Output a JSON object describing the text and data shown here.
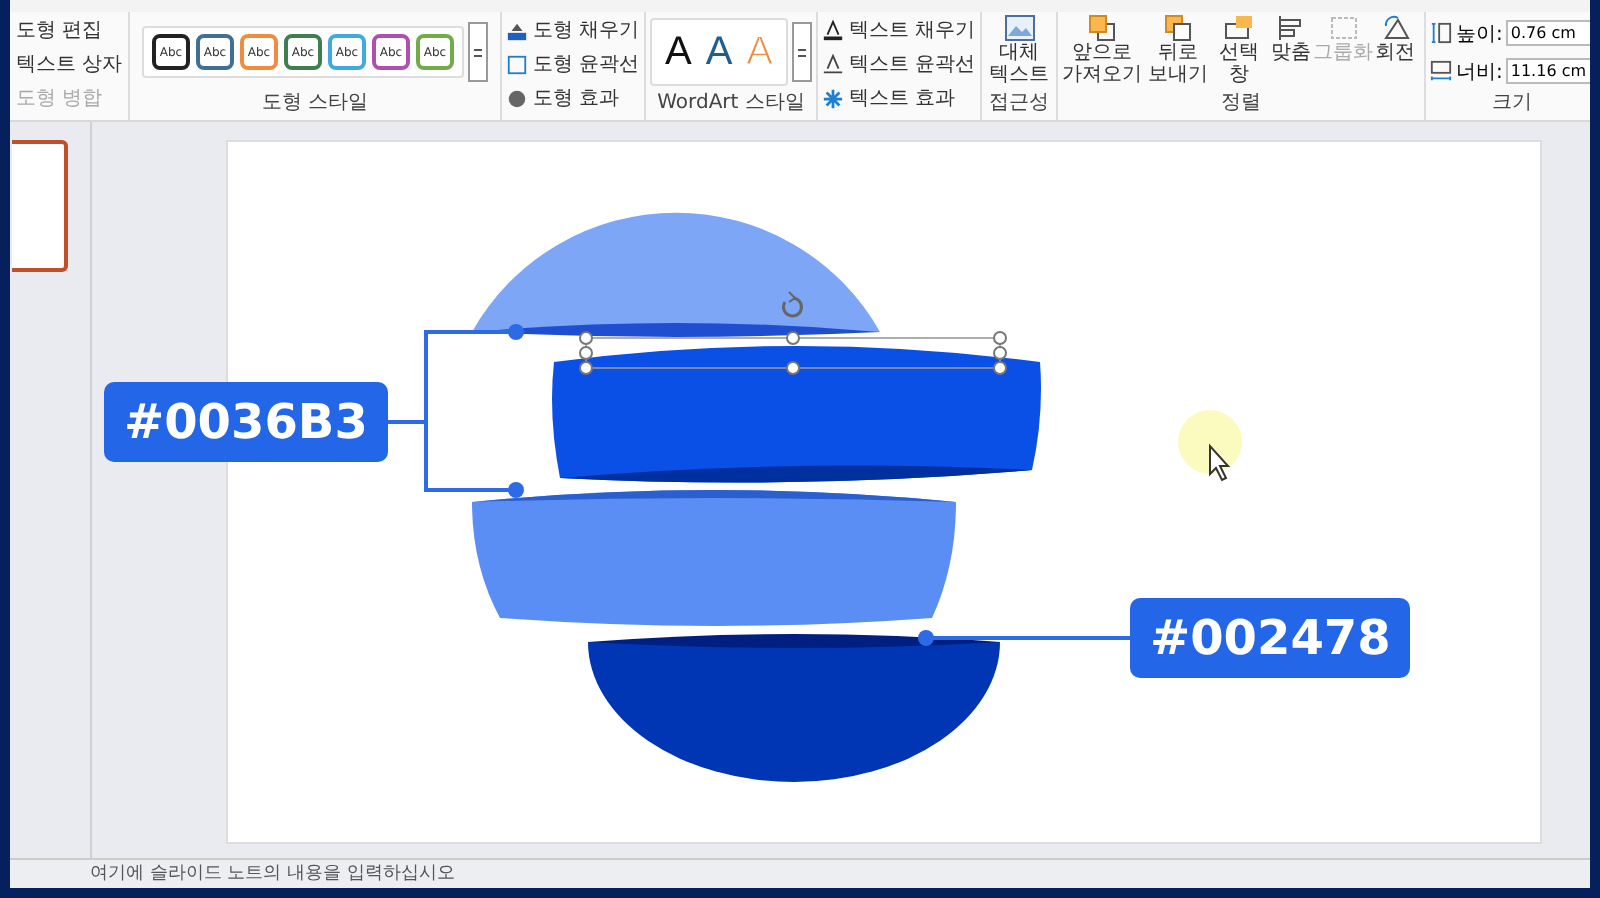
{
  "ribbon": {
    "edit_group": [
      {
        "label": "도형 편집",
        "disabled": false
      },
      {
        "label": "텍스트 상자",
        "disabled": false
      },
      {
        "label": "도형 병합",
        "disabled": true
      }
    ],
    "shape_styles": {
      "swatches": [
        {
          "label": "Abc",
          "color": "#222222"
        },
        {
          "label": "Abc",
          "color": "#3f6f95"
        },
        {
          "label": "Abc",
          "color": "#f08c40"
        },
        {
          "label": "Abc",
          "color": "#3f7f4f"
        },
        {
          "label": "Abc",
          "color": "#3fa9e0"
        },
        {
          "label": "Abc",
          "color": "#b04fb0"
        },
        {
          "label": "Abc",
          "color": "#70ad47"
        }
      ],
      "title": "도형 스타일"
    },
    "shape_format": [
      {
        "label": "도형 채우기",
        "kind": "fill"
      },
      {
        "label": "도형 윤곽선",
        "kind": "outline"
      },
      {
        "label": "도형 효과",
        "kind": "effect"
      }
    ],
    "wordart": {
      "letters": [
        {
          "label": "A",
          "kind": "solid",
          "color": "#111111"
        },
        {
          "label": "A",
          "kind": "solid",
          "color": "#1f5f8f"
        },
        {
          "label": "A",
          "kind": "outline",
          "color": "#f08c40"
        }
      ],
      "title": "WordArt 스타일"
    },
    "text_format": [
      {
        "label": "텍스트 채우기",
        "kind": "fill"
      },
      {
        "label": "텍스트 윤곽선",
        "kind": "outline"
      },
      {
        "label": "텍스트 효과",
        "kind": "effect"
      }
    ],
    "accessibility": {
      "button": "대체 텍스트",
      "title": "접근성"
    },
    "arrange": {
      "buttons": [
        {
          "label": "앞으로 가져오기",
          "kind": "forward",
          "disabled": false
        },
        {
          "label": "뒤로 보내기",
          "kind": "backward",
          "disabled": false
        },
        {
          "label": "선택 창",
          "kind": "pane",
          "disabled": false
        },
        {
          "label": "맞춤",
          "kind": "align",
          "disabled": false
        },
        {
          "label": "그룹화",
          "kind": "group",
          "disabled": true
        },
        {
          "label": "회전",
          "kind": "rotate",
          "disabled": false
        }
      ],
      "title": "정렬"
    },
    "size": {
      "fields": [
        {
          "label": "높이:",
          "value": "0.76 cm",
          "kind": "height"
        },
        {
          "label": "너비:",
          "value": "11.16 cm",
          "kind": "width"
        }
      ],
      "title": "크기"
    }
  },
  "slide": {
    "slices": [
      {
        "color": "#7ea6f6",
        "selected": false
      },
      {
        "color": "#0a4fe6",
        "selected": true
      },
      {
        "color": "#5a8ef5",
        "selected": false
      },
      {
        "color": "#0036b3",
        "selected": false
      }
    ],
    "callouts": [
      {
        "label": "#0036B3",
        "kind": "bracket"
      },
      {
        "label": "#002478",
        "kind": "line"
      }
    ]
  },
  "notes": {
    "placeholder": "여기에 슬라이드 노트의 내용을 입력하십시오"
  }
}
